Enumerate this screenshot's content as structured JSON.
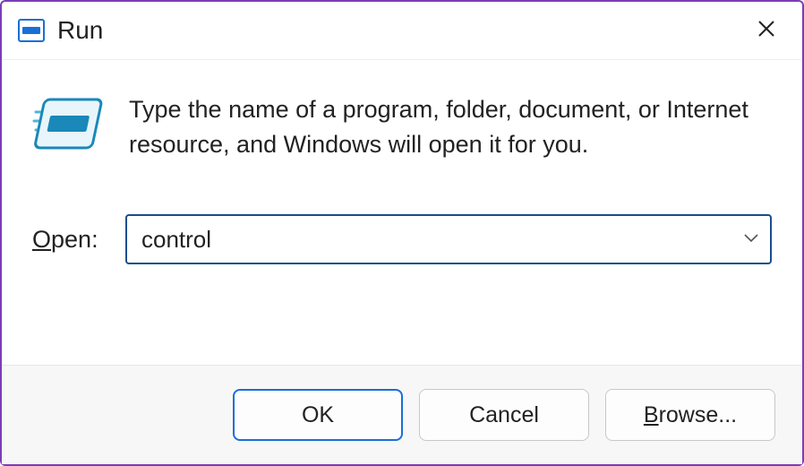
{
  "titlebar": {
    "title": "Run"
  },
  "content": {
    "description": "Type the name of a program, folder, document, or Internet resource, and Windows will open it for you.",
    "open_label_prefix": "O",
    "open_label_rest": "pen:",
    "input_value": "control"
  },
  "footer": {
    "ok_label": "OK",
    "cancel_label": "Cancel",
    "browse_prefix": "B",
    "browse_rest": "rowse..."
  },
  "icons": {
    "title_icon": "run-icon",
    "close": "close-icon",
    "logo": "run-logo-icon",
    "chevron": "chevron-down-icon"
  }
}
